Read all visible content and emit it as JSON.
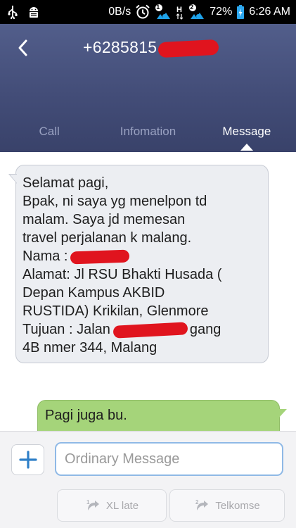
{
  "status_bar": {
    "data_rate": "0B/s",
    "sim1_badge": "1",
    "sim2_badge": "2",
    "battery": "72%",
    "time": "6:26 AM",
    "icons": [
      "usb-icon",
      "android-debug-icon",
      "alarm-clock-icon",
      "sim1-signal-icon",
      "h-data-icon",
      "sim2-signal-icon",
      "battery-charging-icon"
    ]
  },
  "header": {
    "back_icon": "chevron-left-icon",
    "contact_number": "+6285815",
    "tabs": [
      {
        "label": "Call"
      },
      {
        "label": "Infomation"
      },
      {
        "label": "Message"
      }
    ],
    "active_tab": "Message"
  },
  "messages": {
    "incoming": {
      "lines": [
        "Selamat pagi,",
        "Bpak, ni saya  yg menelpon td",
        "malam. Saya jd memesan",
        "travel perjalanan k malang.",
        "Nama :",
        "Alamat: Jl RSU Bhakti Husada (",
        "Depan Kampus AKBID",
        "RUSTIDA) Krikilan, Glenmore",
        "Tujuan :  Jalan",
        "gang",
        "4B nmer 344, Malang"
      ]
    },
    "outgoing": {
      "text": "Pagi juga bu."
    }
  },
  "composer": {
    "add_icon": "plus-icon",
    "input_placeholder": "Ordinary Message",
    "input_value": "",
    "send_buttons": [
      {
        "label": "XL late",
        "icon": "sim1-send-icon"
      },
      {
        "label": "Telkomse",
        "icon": "sim2-send-icon"
      }
    ]
  },
  "colors": {
    "header_top": "#525e8b",
    "header_bottom": "#39426a",
    "incoming_bubble": "#eceef2",
    "outgoing_bubble": "#a5d47a",
    "redaction": "#e0141e",
    "input_border": "#8fb9e6"
  }
}
